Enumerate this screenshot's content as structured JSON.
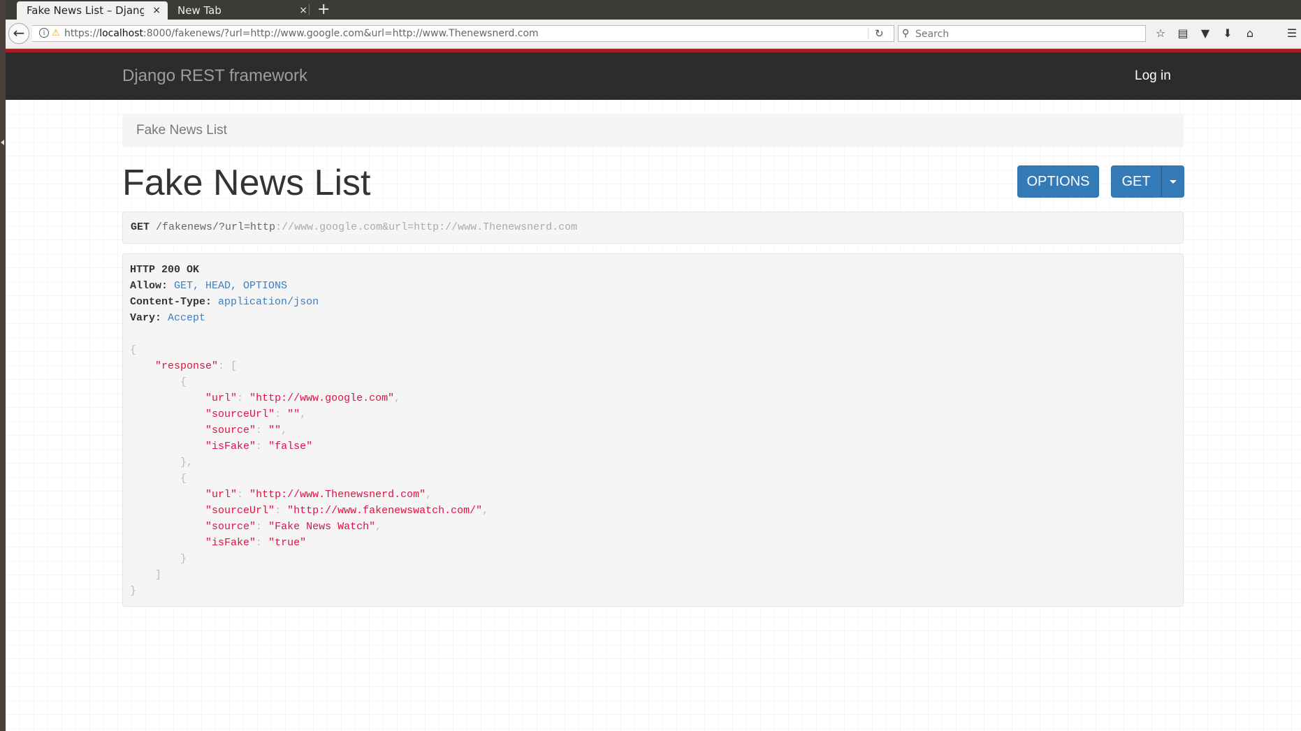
{
  "browser": {
    "tabs": [
      {
        "title": "Fake News List – Djang…",
        "close": "×"
      },
      {
        "title": "New Tab",
        "close": "×"
      }
    ],
    "new_tab_label": "+",
    "url": {
      "scheme": "https://",
      "host": "localhost",
      "rest": ":8000/fakenews/?url=http://www.google.com&url=http://www.Thenewsnerd.com"
    },
    "search_placeholder": "Search"
  },
  "navbar": {
    "brand": "Django REST framework",
    "login": "Log in"
  },
  "breadcrumb": "Fake News List",
  "page_title": "Fake News List",
  "buttons": {
    "options": "OPTIONS",
    "get": "GET"
  },
  "request": {
    "method": "GET",
    "path": "/fakenews",
    "query_start": "/?url=http",
    "query_rest": "://www.google.com&url=http://www.Thenewsnerd.com"
  },
  "response": {
    "status": "HTTP 200 OK",
    "headers": [
      {
        "key": "Allow:",
        "value": "GET, HEAD, OPTIONS"
      },
      {
        "key": "Content-Type:",
        "value": "application/json"
      },
      {
        "key": "Vary:",
        "value": "Accept"
      }
    ],
    "body_key": "\"response\"",
    "items": [
      {
        "fields": [
          {
            "key": "\"url\"",
            "value": "\"http://www.google.com\"",
            "comma": ","
          },
          {
            "key": "\"sourceUrl\"",
            "value": "\"\"",
            "comma": ","
          },
          {
            "key": "\"source\"",
            "value": "\"\"",
            "comma": ","
          },
          {
            "key": "\"isFake\"",
            "value": "\"false\"",
            "comma": ""
          }
        ]
      },
      {
        "fields": [
          {
            "key": "\"url\"",
            "value": "\"http://www.Thenewsnerd.com\"",
            "comma": ","
          },
          {
            "key": "\"sourceUrl\"",
            "value": "\"http://www.fakenewswatch.com/\"",
            "comma": ","
          },
          {
            "key": "\"source\"",
            "value": "\"Fake News Watch\"",
            "comma": ","
          },
          {
            "key": "\"isFake\"",
            "value": "\"true\"",
            "comma": ""
          }
        ]
      }
    ]
  }
}
